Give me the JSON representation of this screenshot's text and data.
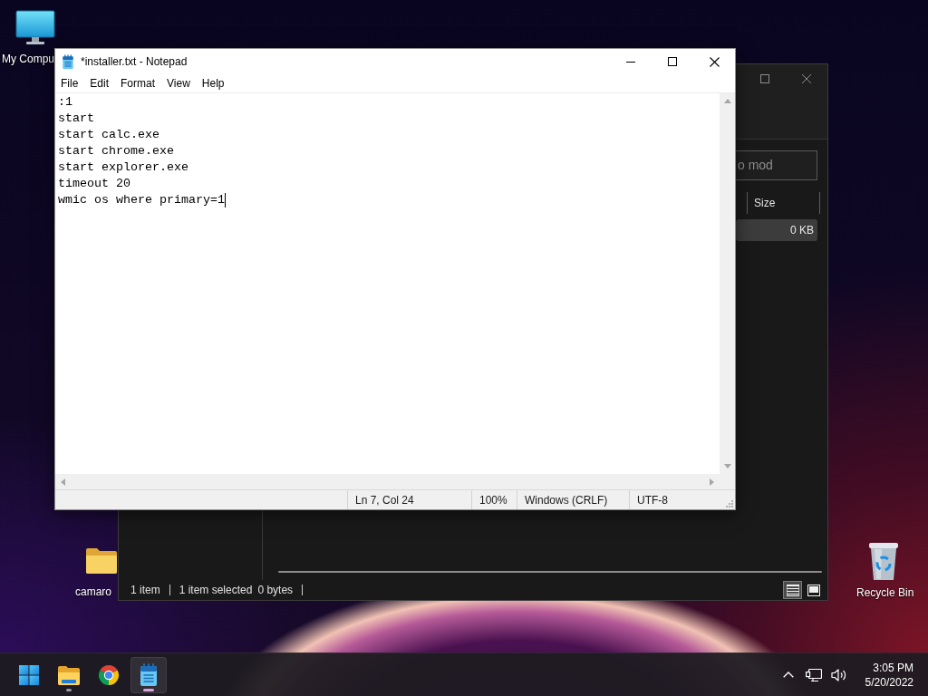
{
  "desktop_icons": [
    {
      "kind": "computer",
      "label": "My Compu"
    },
    {
      "kind": "folder",
      "label": "camaro"
    },
    {
      "kind": "recycle-bin",
      "label": "Recycle Bin"
    }
  ],
  "explorer": {
    "search": {
      "placeholder": "o mod"
    },
    "columns": [
      "Size"
    ],
    "rows": [
      {
        "size": "0 KB",
        "selected": true
      }
    ],
    "status": {
      "count": "1 item",
      "selection": "1 item selected",
      "size": "0 bytes"
    },
    "views": [
      {
        "kind": "details",
        "selected": true
      },
      {
        "kind": "large-icons",
        "selected": false
      }
    ]
  },
  "notepad": {
    "title": "*installer.txt - Notepad",
    "menu": [
      "File",
      "Edit",
      "Format",
      "View",
      "Help"
    ],
    "lines": [
      ":1",
      "start",
      "start calc.exe",
      "start chrome.exe",
      "start explorer.exe",
      "timeout 20",
      "wmic os where primary=1"
    ],
    "status": [
      "Ln 7, Col 24",
      "100%",
      "Windows (CRLF)",
      "UTF-8"
    ]
  },
  "taskbar": {
    "apps": [
      {
        "kind": "start",
        "running": false,
        "active": false
      },
      {
        "kind": "file-explorer",
        "running": true,
        "active": false
      },
      {
        "kind": "browser",
        "running": false,
        "active": false
      },
      {
        "kind": "notepad",
        "running": true,
        "active": true
      }
    ],
    "clock": {
      "time": "3:05 PM",
      "date": "5/20/2022"
    }
  }
}
